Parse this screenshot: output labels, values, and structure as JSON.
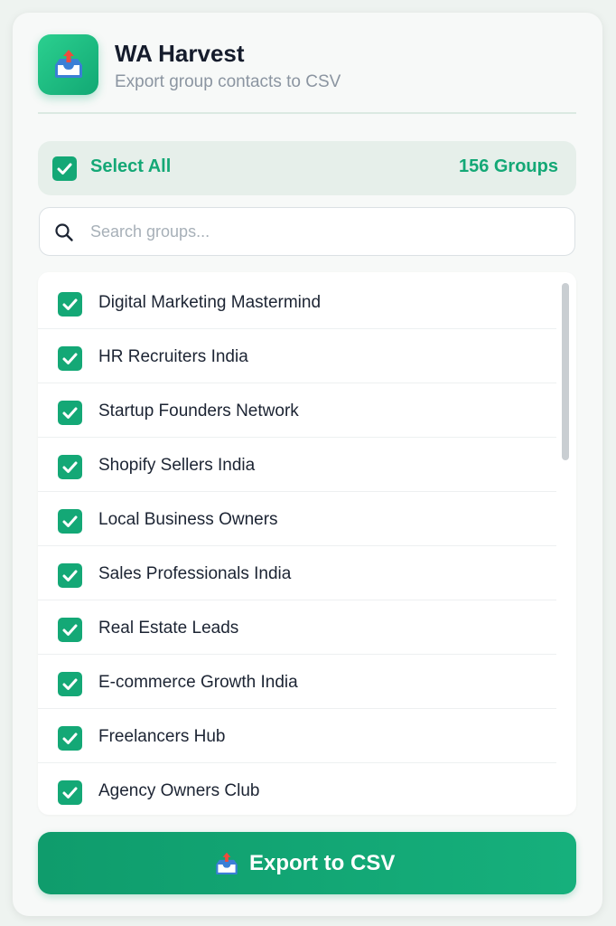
{
  "app": {
    "title": "WA Harvest",
    "subtitle": "Export group contacts to CSV",
    "icon": "inbox-tray-upload-icon"
  },
  "select_all": {
    "label": "Select All",
    "checked": true,
    "count_label": "156 Groups"
  },
  "search": {
    "placeholder": "Search groups...",
    "value": ""
  },
  "groups": [
    {
      "name": "Digital Marketing Mastermind",
      "checked": true
    },
    {
      "name": "HR Recruiters India",
      "checked": true
    },
    {
      "name": "Startup Founders Network",
      "checked": true
    },
    {
      "name": "Shopify Sellers India",
      "checked": true
    },
    {
      "name": "Local Business Owners",
      "checked": true
    },
    {
      "name": "Sales Professionals India",
      "checked": true
    },
    {
      "name": "Real Estate Leads",
      "checked": true
    },
    {
      "name": "E-commerce Growth India",
      "checked": true
    },
    {
      "name": "Freelancers Hub",
      "checked": true
    },
    {
      "name": "Agency Owners Club",
      "checked": true
    }
  ],
  "export_button": {
    "label": "Export to CSV",
    "icon": "inbox-tray-upload-icon"
  },
  "colors": {
    "accent": "#14a876",
    "accent_light": "#2bd08f",
    "title_text": "#151c2c",
    "muted_text": "#8b95a1"
  }
}
